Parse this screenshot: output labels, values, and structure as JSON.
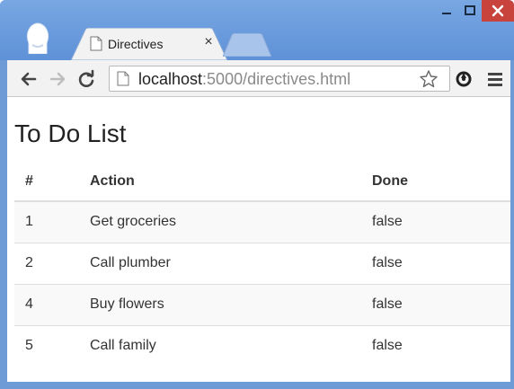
{
  "browser": {
    "tab": {
      "title": "Directives",
      "close_glyph": "×"
    },
    "address_bar": {
      "host": "localhost",
      "rest": ":5000/directives.html"
    },
    "icons": {
      "profile": "profile-icon",
      "page": "page-icon",
      "back": "back-arrow-icon",
      "forward": "forward-arrow-icon",
      "reload": "reload-icon",
      "star": "bookmark-star-icon",
      "extension": "extension-icon",
      "menu": "hamburger-menu-icon",
      "minimize": "minimize-icon",
      "maximize": "maximize-icon",
      "close": "close-icon"
    },
    "colors": {
      "frame": "#6e9ad6",
      "close_button": "#c8433b",
      "toolbar": "#f2f2f2"
    }
  },
  "page": {
    "title": "To Do List",
    "table": {
      "headers": [
        "#",
        "Action",
        "Done"
      ],
      "rows": [
        {
          "num": "1",
          "action": "Get groceries",
          "done": "false"
        },
        {
          "num": "2",
          "action": "Call plumber",
          "done": "false"
        },
        {
          "num": "4",
          "action": "Buy flowers",
          "done": "false"
        },
        {
          "num": "5",
          "action": "Call family",
          "done": "false"
        }
      ]
    }
  }
}
